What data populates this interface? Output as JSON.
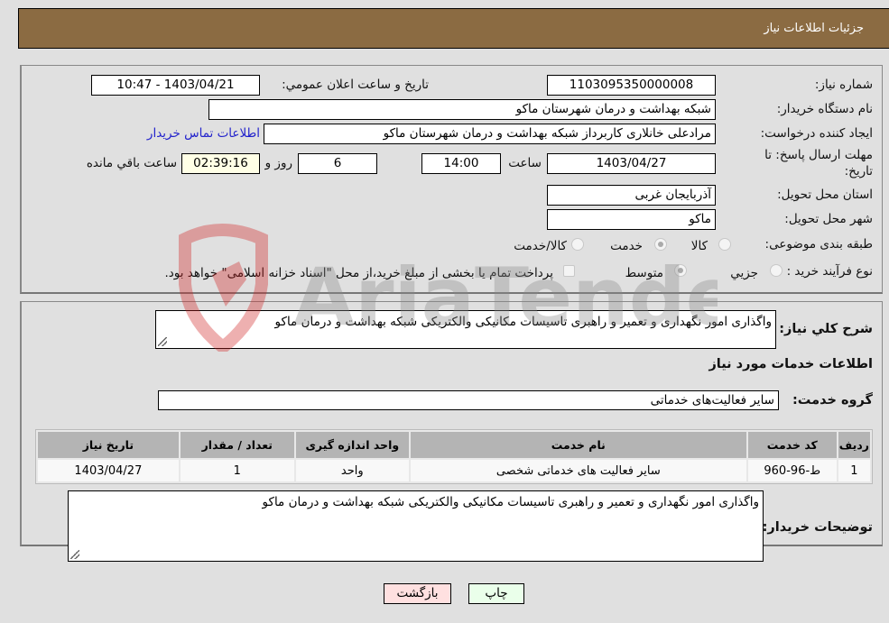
{
  "header": {
    "title": "جزئیات اطلاعات نیاز"
  },
  "form": {
    "need_number": {
      "label": "شماره نیاز:",
      "value": "1103095350000008"
    },
    "announce_datetime": {
      "label": "تاریخ و ساعت اعلان عمومي:",
      "value": "1403/04/21 - 10:47"
    },
    "buyer_org": {
      "label": "نام دستگاه خریدار:",
      "value": "شبکه بهداشت و درمان شهرستان ماکو"
    },
    "requester": {
      "label": "ایجاد کننده درخواست:",
      "value": "مرادعلی خانلاری کاربرداز شبکه بهداشت و درمان شهرستان ماکو"
    },
    "buyer_contact_link": "اطلاعات تماس خریدار",
    "deadline": {
      "label_line1": "مهلت ارسال پاسخ: تا",
      "label_line2": "تاریخ:",
      "date": "1403/04/27",
      "time_label": "ساعت",
      "time": "14:00",
      "days": "6",
      "days_label": "روز و",
      "remaining": "02:39:16",
      "remaining_label": "ساعت باقي مانده"
    },
    "province": {
      "label": "استان محل تحویل:",
      "value": "آذربایجان غربی"
    },
    "city": {
      "label": "شهر محل تحویل:",
      "value": "ماکو"
    },
    "category": {
      "label": "طبقه بندی موضوعی:",
      "options": [
        "کالا",
        "خدمت",
        "کالا/خدمت"
      ],
      "selected": "خدمت"
    },
    "purchase_type": {
      "label": "نوع فرآیند خرید :",
      "options": [
        "جزيي",
        "متوسط"
      ],
      "selected": "متوسط",
      "treasury_checkbox": "پرداخت تمام یا بخشی از مبلغ خرید،از محل \"اسناد خزانه اسلامی\" خواهد بود.",
      "treasury_checked": false
    }
  },
  "details": {
    "description_label": "شرح کلي نیاز:",
    "description": "واگذاری امور نگهداری و تعمیر و راهبری تاسیسات مکانیکی والکتریکی شبکه بهداشت و درمان ماکو",
    "services_heading": "اطلاعات خدمات مورد نیاز",
    "service_group_label": "گروه خدمت:",
    "service_group": "سایر فعالیت‌های خدماتی",
    "table": {
      "headers": [
        "ردیف",
        "کد خدمت",
        "نام خدمت",
        "واحد اندازه گیری",
        "تعداد / مقدار",
        "تاریخ نیاز"
      ],
      "rows": [
        [
          "1",
          "ط-96-960",
          "سایر فعالیت های خدماتی شخصی",
          "واحد",
          "1",
          "1403/04/27"
        ]
      ]
    },
    "buyer_notes_label": "توضیحات خریدار:",
    "buyer_notes": "واگذاری امور نگهداری و تعمیر و راهبری تاسیسات مکانیکی والکتریکی شبکه بهداشت و درمان ماکو"
  },
  "buttons": {
    "print": "چاپ",
    "back": "بازگشت"
  },
  "watermark": "AriaTender.neT",
  "colors": {
    "header_bg": "#8b6b42",
    "link": "#2222cc",
    "back_btn": "#ffe0e0",
    "print_btn": "#eaffea"
  }
}
